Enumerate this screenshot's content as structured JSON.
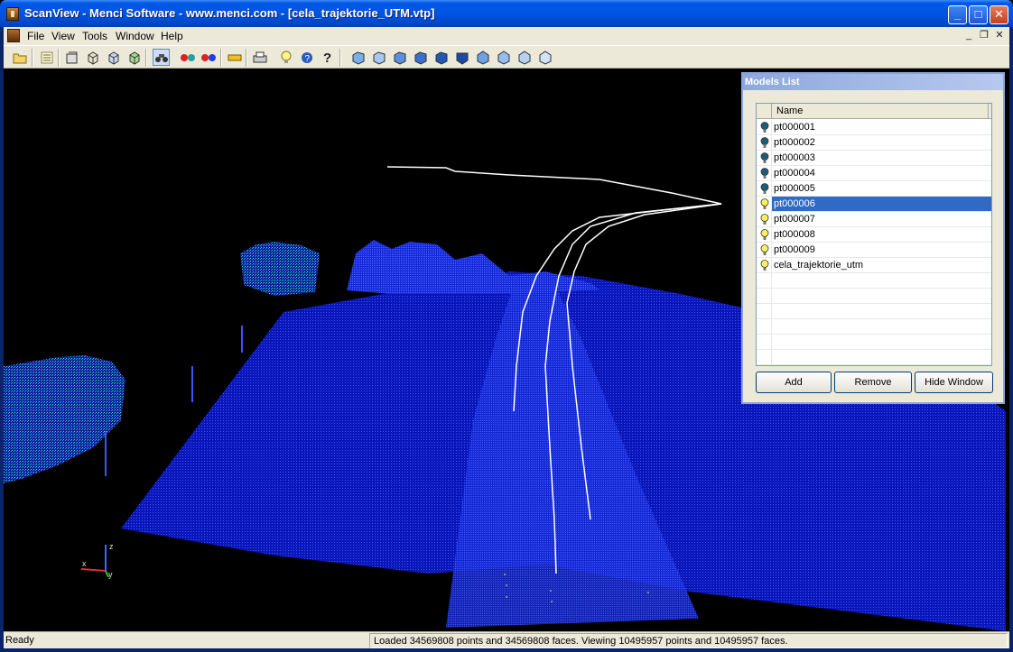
{
  "window": {
    "title": "ScanView - Menci Software - www.menci.com - [cela_trajektorie_UTM.vtp]"
  },
  "titlebar_buttons": {
    "minimize": "_",
    "maximize": "□",
    "close": "✕"
  },
  "menu": {
    "items": [
      {
        "label": "File"
      },
      {
        "label": "View"
      },
      {
        "label": "Tools"
      },
      {
        "label": "Window"
      },
      {
        "label": "Help"
      }
    ],
    "mdi_controls": {
      "minimize": "_",
      "restore": "❐",
      "close": "✕"
    }
  },
  "toolbar": {
    "icons": [
      "open-folder-icon",
      "list-icon",
      "properties-icon",
      "cube-view-icon",
      "cube-view-2-icon",
      "cube-grid-icon",
      "binoculars-icon",
      "stereo-red-icon",
      "stereo-blue-icon",
      "ruler-icon",
      "print-icon",
      "light-bulb-icon",
      "help-icon",
      "question-icon",
      "view-front-icon",
      "view-back-icon",
      "view-left-icon",
      "view-right-icon",
      "view-top-icon",
      "view-bottom-icon",
      "view-iso-1-icon",
      "view-iso-2-icon",
      "view-iso-3-icon",
      "view-iso-4-icon"
    ]
  },
  "models_list": {
    "title": "Models List",
    "column_header": "Name",
    "rows": [
      {
        "name": "pt000001",
        "state": "off",
        "selected": false
      },
      {
        "name": "pt000002",
        "state": "off",
        "selected": false
      },
      {
        "name": "pt000003",
        "state": "off",
        "selected": false
      },
      {
        "name": "pt000004",
        "state": "off",
        "selected": false
      },
      {
        "name": "pt000005",
        "state": "off",
        "selected": false
      },
      {
        "name": "pt000006",
        "state": "on",
        "selected": true
      },
      {
        "name": "pt000007",
        "state": "on",
        "selected": false
      },
      {
        "name": "pt000008",
        "state": "on",
        "selected": false
      },
      {
        "name": "pt000009",
        "state": "on",
        "selected": false
      },
      {
        "name": "cela_trajektorie_utm",
        "state": "on",
        "selected": false
      }
    ],
    "buttons": {
      "add": "Add",
      "remove": "Remove",
      "hide": "Hide Window"
    }
  },
  "axes": {
    "x": "x",
    "y": "y",
    "z": "z"
  },
  "status": {
    "left": "Ready",
    "message": "Loaded 34569808 points and 34569808 faces. Viewing 10495957 points and 10495957 faces."
  },
  "colors": {
    "cloud": "#1a2bff",
    "trajectory": "#ffffff",
    "vegetation": "#35e0c0",
    "selection": "#316ac5"
  }
}
